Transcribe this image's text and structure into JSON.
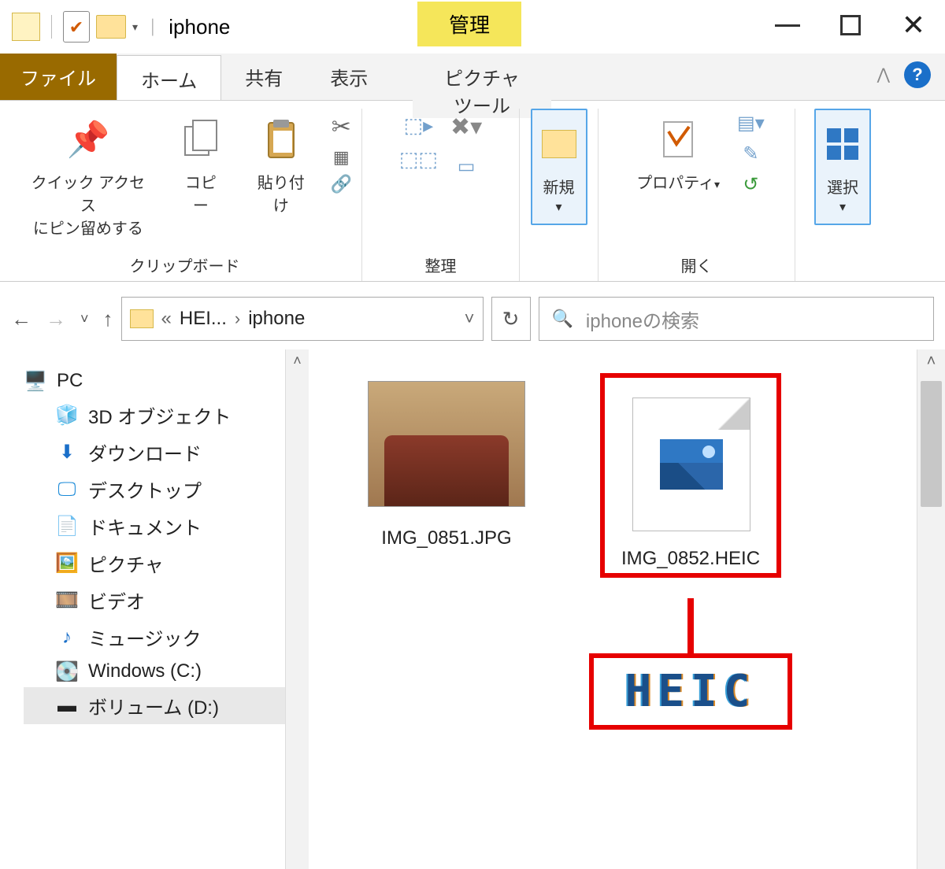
{
  "title": "iphone",
  "manageTab": "管理",
  "tabs": {
    "file": "ファイル",
    "home": "ホーム",
    "share": "共有",
    "view": "表示",
    "pictureTools": "ピクチャ ツール"
  },
  "ribbon": {
    "pinQuickAccess": "クイック アクセス\nにピン留めする",
    "copy": "コピー",
    "paste": "貼り付け",
    "clipboardGroup": "クリップボード",
    "organizeGroup": "整理",
    "new": "新規",
    "properties": "プロパティ",
    "openGroup": "開く",
    "select": "選択"
  },
  "address": {
    "crumb1": "HEI...",
    "crumb2": "iphone"
  },
  "search": {
    "placeholder": "iphoneの検索"
  },
  "nav": {
    "pc": "PC",
    "objects3d": "3D オブジェクト",
    "downloads": "ダウンロード",
    "desktop": "デスクトップ",
    "documents": "ドキュメント",
    "pictures": "ピクチャ",
    "videos": "ビデオ",
    "music": "ミュージック",
    "drivec": "Windows (C:)",
    "drived": "ボリューム (D:)"
  },
  "files": {
    "jpg": "IMG_0851.JPG",
    "heic": "IMG_0852.HEIC"
  },
  "annotation": "HEIC"
}
